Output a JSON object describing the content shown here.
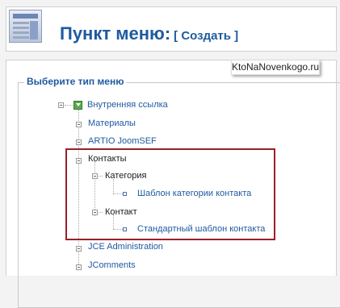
{
  "header": {
    "title": "Пункт меню:",
    "action": "[ Создать ]"
  },
  "watermark": "KtoNaNovenkogo.ru",
  "panel": {
    "legend": "Выберите тип меню"
  },
  "tree": {
    "root_item": "Внутренняя ссылка",
    "items": [
      "Материалы",
      "ARTIO JoomSEF",
      "Контакты",
      "Категория",
      "Шаблон категории контакта",
      "Контакт",
      "Стандартный шаблон контакта",
      "JCE Administration",
      "JComments"
    ]
  },
  "colors": {
    "link": "#1f5aa0",
    "highlight_border": "#9a1f2a",
    "icon_green": "#5aa84d"
  }
}
